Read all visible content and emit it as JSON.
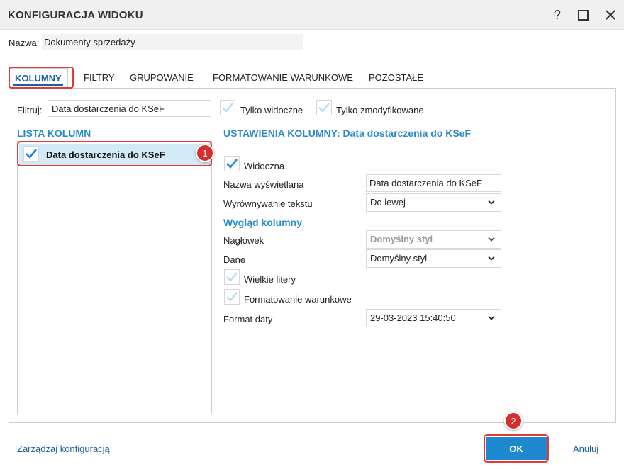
{
  "window": {
    "title": "KONFIGURACJA WIDOKU",
    "help_glyph": "?",
    "icons": [
      "help-icon",
      "maximize-icon",
      "close-icon"
    ]
  },
  "name": {
    "label": "Nazwa:",
    "value": "Dokumenty sprzedaży"
  },
  "tabs": [
    {
      "label": "KOLUMNY",
      "active": true
    },
    {
      "label": "FILTRY",
      "active": false
    },
    {
      "label": "GRUPOWANIE",
      "active": false
    },
    {
      "label": "FORMATOWANIE WARUNKOWE",
      "active": false
    },
    {
      "label": "POZOSTAŁE",
      "active": false
    }
  ],
  "filter": {
    "label": "Filtruj:",
    "value": "Data dostarczenia do KSeF",
    "only_visible_label": "Tylko widoczne",
    "only_visible_checked": false,
    "only_modified_label": "Tylko zmodyfikowane",
    "only_modified_checked": false
  },
  "column_list": {
    "title": "LISTA KOLUMN",
    "items": [
      {
        "label": "Data dostarczenia do KSeF",
        "checked": true,
        "selected": true
      }
    ]
  },
  "settings": {
    "title": "USTAWIENIA KOLUMNY: Data dostarczenia do KSeF",
    "visible_label": "Widoczna",
    "visible_checked": true,
    "display_name_label": "Nazwa wyświetlana",
    "display_name_value": "Data dostarczenia do KSeF",
    "alignment_label": "Wyrównywanie tekstu",
    "alignment_value": "Do lewej",
    "appearance_title": "Wygląd kolumny",
    "header_label": "Nagłówek",
    "header_value": "Domyślny styl",
    "data_label": "Dane",
    "data_value": "Domyślny styl",
    "uppercase_label": "Wielkie litery",
    "uppercase_checked": false,
    "conditional_label": "Formatowanie warunkowe",
    "conditional_checked": false,
    "date_format_label": "Format daty",
    "date_format_value": "29-03-2023 15:40:50"
  },
  "footer": {
    "manage_link": "Zarządzaj konfiguracją",
    "ok_label": "OK",
    "cancel_label": "Anuluj"
  },
  "annotations": {
    "badge_1": "1",
    "badge_2": "2"
  },
  "colors": {
    "accent": "#2a8cc7",
    "primary_button": "#1e88cf",
    "selection": "#d2ebf7",
    "highlight": "#e53935",
    "badge": "#d32f2f"
  }
}
